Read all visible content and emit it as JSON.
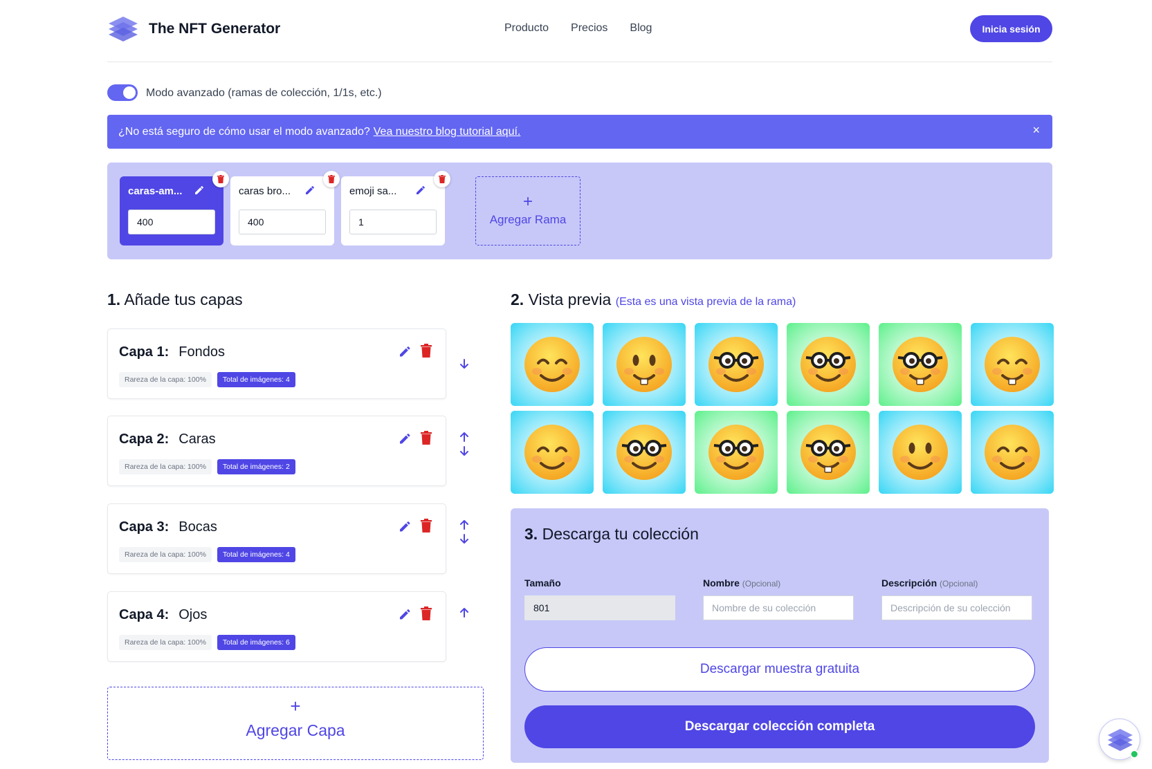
{
  "header": {
    "brand": "The NFT Generator",
    "nav": [
      "Producto",
      "Precios",
      "Blog"
    ],
    "signin": "Inicia sesión"
  },
  "advanced_mode": {
    "enabled": true,
    "label": "Modo avanzado (ramas de colección, 1/1s, etc.)"
  },
  "banner": {
    "text": "¿No está seguro de cómo usar el modo avanzado?",
    "link": "Vea nuestro blog tutorial aquí.",
    "close": "×"
  },
  "branches": [
    {
      "name": "caras-am...",
      "value": "400",
      "active": true
    },
    {
      "name": "caras bro...",
      "value": "400",
      "active": false
    },
    {
      "name": "emoji sa...",
      "value": "1",
      "active": false
    }
  ],
  "add_branch": {
    "plus": "+",
    "label": "Agregar Rama"
  },
  "layers_section": {
    "number": "1.",
    "title": "Añade tus capas"
  },
  "layers": [
    {
      "label": "Capa 1:",
      "name": "Fondos",
      "rarity": "Rareza de la capa: 100%",
      "total": "Total de imágenes: 4",
      "up": false,
      "down": true
    },
    {
      "label": "Capa 2:",
      "name": "Caras",
      "rarity": "Rareza de la capa: 100%",
      "total": "Total de imágenes: 2",
      "up": true,
      "down": true
    },
    {
      "label": "Capa 3:",
      "name": "Bocas",
      "rarity": "Rareza de la capa: 100%",
      "total": "Total de imágenes: 4",
      "up": true,
      "down": true
    },
    {
      "label": "Capa 4:",
      "name": "Ojos",
      "rarity": "Rareza de la capa: 100%",
      "total": "Total de imágenes: 6",
      "up": true,
      "down": false
    }
  ],
  "add_layer": {
    "plus": "+",
    "label": "Agregar Capa"
  },
  "preview_section": {
    "number": "2.",
    "title": "Vista previa",
    "subtitle": "(Esta es una vista previa de la rama)"
  },
  "preview_tiles": [
    {
      "bg": "blue",
      "eyes": "happy",
      "mouth": "smile"
    },
    {
      "bg": "blue",
      "eyes": "oval",
      "mouth": "teeth"
    },
    {
      "bg": "blue",
      "eyes": "glasses",
      "mouth": "smile"
    },
    {
      "bg": "green",
      "eyes": "glasses",
      "mouth": "smile"
    },
    {
      "bg": "green",
      "eyes": "glasses",
      "mouth": "teeth"
    },
    {
      "bg": "blue",
      "eyes": "happy",
      "mouth": "teeth"
    },
    {
      "bg": "blue",
      "eyes": "happy",
      "mouth": "smile"
    },
    {
      "bg": "blue",
      "eyes": "glasses",
      "mouth": "smile"
    },
    {
      "bg": "green",
      "eyes": "glasses",
      "mouth": "smile"
    },
    {
      "bg": "green",
      "eyes": "glasses",
      "mouth": "teeth"
    },
    {
      "bg": "blue",
      "eyes": "oval",
      "mouth": "smile"
    },
    {
      "bg": "blue",
      "eyes": "happy",
      "mouth": "smile"
    }
  ],
  "download_section": {
    "number": "3.",
    "title": "Descarga tu colección",
    "size_label": "Tamaño",
    "size_value": "801",
    "name_label": "Nombre",
    "name_optional": "(Opcional)",
    "name_placeholder": "Nombre de su colección",
    "desc_label": "Descripción",
    "desc_optional": "(Opcional)",
    "desc_placeholder": "Descripción de su colección",
    "free_button": "Descargar muestra gratuita",
    "full_button": "Descargar colección completa"
  },
  "colors": {
    "accent": "#4f46e5",
    "banner": "#6366f1",
    "panel": "#c7c8f8",
    "delete": "#dc2626",
    "tile_blue": "#38d6f5",
    "tile_green": "#5ef08c"
  }
}
